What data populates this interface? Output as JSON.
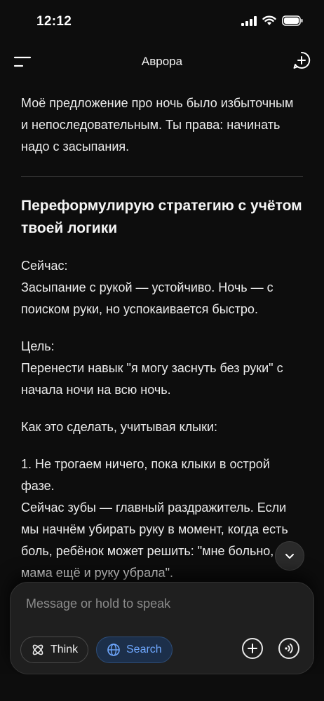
{
  "status": {
    "time": "12:12"
  },
  "header": {
    "title": "Аврора"
  },
  "message": {
    "intro": "Моё предложение про ночь было избыточным и непоследовательным. Ты права: начинать надо с засыпания.",
    "heading": "Переформулирую стратегию с учётом твоей логики",
    "now_label": "Сейчас:",
    "now_text": "Засыпание с рукой — устойчиво. Ночь — с поиском руки, но успокаивается быстро.",
    "goal_label": "Цель:",
    "goal_text": "Перенести навык \"я могу заснуть без руки\" с начала ночи на всю ночь.",
    "how_label": "Как это сделать, учитывая клыки:",
    "step1_title": "1. Не трогаем ничего, пока клыки в острой фазе.",
    "step1_text": "Сейчас зубы — главный раздражитель. Если мы начнём убирать руку в момент, когда есть боль, ребёнок может решить: \"мне больно, а мама ещё и руку убрала\"."
  },
  "composer": {
    "placeholder": "Message or hold to speak",
    "think_label": "Think",
    "search_label": "Search"
  },
  "icons": {
    "menu": "menu-icon",
    "new_chat": "new-chat-icon",
    "scroll_down": "chevron-down-icon",
    "think": "atom-icon",
    "search": "globe-icon",
    "attach": "plus-icon",
    "voice": "voice-wave-icon"
  },
  "colors": {
    "accent": "#6fa8ff",
    "background": "#0d0d0d"
  }
}
